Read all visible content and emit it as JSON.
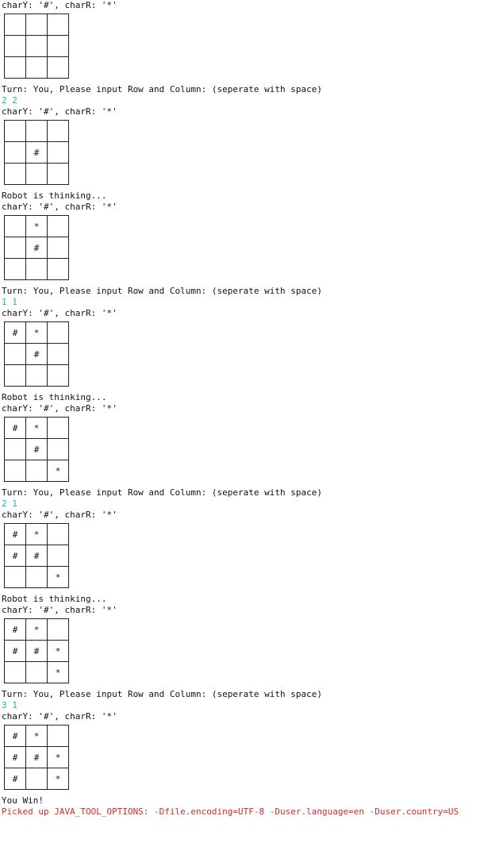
{
  "colors": {
    "input_echo": "#1fb8a4",
    "warning": "#d42b2b",
    "text": "#111111",
    "background": "#ffffff"
  },
  "blocks": [
    {
      "type": "text",
      "text": "charY: '#', charR: '*'"
    },
    {
      "type": "board",
      "cells": [
        [
          "",
          "",
          ""
        ],
        [
          "",
          "",
          ""
        ],
        [
          "",
          "",
          ""
        ]
      ]
    },
    {
      "type": "text",
      "text": "Turn: You, Please input Row and Column: (seperate with space)"
    },
    {
      "type": "input",
      "text": "2 2"
    },
    {
      "type": "text",
      "text": "charY: '#', charR: '*'"
    },
    {
      "type": "board",
      "cells": [
        [
          "",
          "",
          ""
        ],
        [
          "",
          "#",
          ""
        ],
        [
          "",
          "",
          ""
        ]
      ]
    },
    {
      "type": "text",
      "text": "Robot is thinking..."
    },
    {
      "type": "text",
      "text": "charY: '#', charR: '*'"
    },
    {
      "type": "board",
      "cells": [
        [
          "",
          "*",
          ""
        ],
        [
          "",
          "#",
          ""
        ],
        [
          "",
          "",
          ""
        ]
      ]
    },
    {
      "type": "text",
      "text": "Turn: You, Please input Row and Column: (seperate with space)"
    },
    {
      "type": "input",
      "text": "1 1"
    },
    {
      "type": "text",
      "text": "charY: '#', charR: '*'"
    },
    {
      "type": "board",
      "cells": [
        [
          "#",
          "*",
          ""
        ],
        [
          "",
          "#",
          ""
        ],
        [
          "",
          "",
          ""
        ]
      ]
    },
    {
      "type": "text",
      "text": "Robot is thinking..."
    },
    {
      "type": "text",
      "text": "charY: '#', charR: '*'"
    },
    {
      "type": "board",
      "cells": [
        [
          "#",
          "*",
          ""
        ],
        [
          "",
          "#",
          ""
        ],
        [
          "",
          "",
          "*"
        ]
      ]
    },
    {
      "type": "text",
      "text": "Turn: You, Please input Row and Column: (seperate with space)"
    },
    {
      "type": "input",
      "text": "2 1"
    },
    {
      "type": "text",
      "text": "charY: '#', charR: '*'"
    },
    {
      "type": "board",
      "cells": [
        [
          "#",
          "*",
          ""
        ],
        [
          "#",
          "#",
          ""
        ],
        [
          "",
          "",
          "*"
        ]
      ]
    },
    {
      "type": "text",
      "text": "Robot is thinking..."
    },
    {
      "type": "text",
      "text": "charY: '#', charR: '*'"
    },
    {
      "type": "board",
      "cells": [
        [
          "#",
          "*",
          ""
        ],
        [
          "#",
          "#",
          "*"
        ],
        [
          "",
          "",
          "*"
        ]
      ]
    },
    {
      "type": "text",
      "text": "Turn: You, Please input Row and Column: (seperate with space)"
    },
    {
      "type": "input",
      "text": "3 1"
    },
    {
      "type": "text",
      "text": "charY: '#', charR: '*'"
    },
    {
      "type": "board",
      "cells": [
        [
          "#",
          "*",
          ""
        ],
        [
          "#",
          "#",
          "*"
        ],
        [
          "#",
          "",
          "*"
        ]
      ]
    },
    {
      "type": "text",
      "text": "You Win!"
    },
    {
      "type": "warning",
      "text": "Picked up JAVA_TOOL_OPTIONS: -Dfile.encoding=UTF-8 -Duser.language=en -Duser.country=US"
    }
  ]
}
